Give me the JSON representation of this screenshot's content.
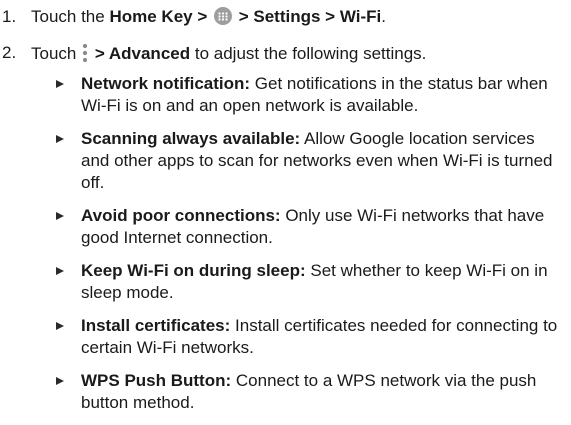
{
  "steps": [
    {
      "number": "1.",
      "prefix": "Touch the",
      "home_key": "Home Key >",
      "arrow_sep": "> Settings > Wi-Fi",
      "period": "."
    },
    {
      "number": "2.",
      "prefix": "Touch",
      "advanced": "> Advanced",
      "suffix": "to adjust the following settings."
    }
  ],
  "settings": [
    {
      "title": "Network notification:",
      "text": "Get notifications in the status bar when Wi-Fi is on and an open network is available."
    },
    {
      "title": "Scanning always available:",
      "text": "Allow Google location services and other apps to scan for networks even when Wi-Fi is turned off."
    },
    {
      "title": "Avoid poor connections:",
      "text": "Only use Wi-Fi networks that have good Internet connection."
    },
    {
      "title": "Keep Wi-Fi on during sleep:",
      "text": "Set whether to keep Wi-Fi on in sleep mode."
    },
    {
      "title": "Install certificates:",
      "text": "Install certificates needed for connecting to certain Wi-Fi networks."
    },
    {
      "title": "WPS Push Button:",
      "text": "Connect to a WPS network via the push button method."
    }
  ],
  "icons": {
    "home_icon": "app-drawer-icon",
    "menu_icon": "more-options-icon",
    "bullet": "triangle-bullet-icon"
  }
}
